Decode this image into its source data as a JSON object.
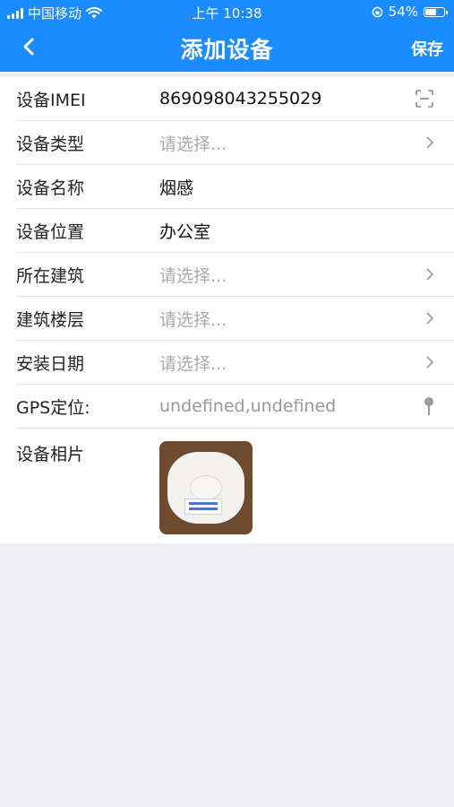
{
  "status_bar": {
    "carrier": "中国移动",
    "time": "上午 10:38",
    "battery": "54%"
  },
  "nav": {
    "title": "添加设备",
    "save_label": "保存"
  },
  "form": {
    "rows": [
      {
        "label": "设备IMEI",
        "value": "869098043255029"
      },
      {
        "label": "设备类型",
        "value": "请选择..."
      },
      {
        "label": "设备名称",
        "value": "烟感"
      },
      {
        "label": "设备位置",
        "value": "办公室"
      },
      {
        "label": "所在建筑",
        "value": "请选择..."
      },
      {
        "label": "建筑楼层",
        "value": "请选择..."
      },
      {
        "label": "安装日期",
        "value": "请选择..."
      },
      {
        "label": "GPS定位:",
        "value": "undefined,undefined"
      },
      {
        "label": "设备相片",
        "value": ""
      }
    ]
  },
  "colors": {
    "header_bg": "#1a8cff",
    "page_bg": "#efeff4",
    "placeholder": "#aaaaaa"
  }
}
